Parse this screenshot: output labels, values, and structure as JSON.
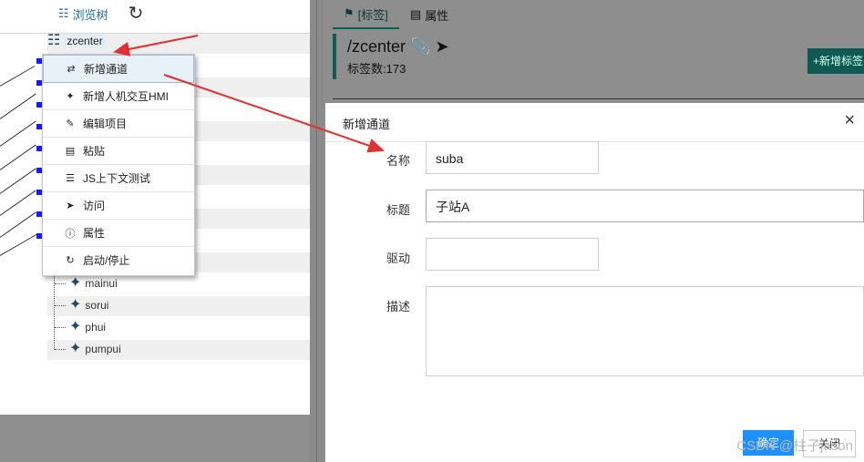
{
  "tree": {
    "header_label": "浏览树",
    "root": "zcenter",
    "children": [
      "mainui",
      "sorui",
      "phui",
      "pumpui"
    ]
  },
  "context_menu": {
    "items": [
      {
        "icon": "shuffle-icon",
        "label": "新增通道"
      },
      {
        "icon": "puzzle-icon",
        "label": "新增人机交互HMI"
      },
      {
        "icon": "pencil-icon",
        "label": "编辑项目"
      },
      {
        "icon": "clipboard-icon",
        "label": "粘贴"
      },
      {
        "icon": "list-icon",
        "label": "JS上下文测试"
      },
      {
        "icon": "send-icon",
        "label": "访问"
      },
      {
        "icon": "info-icon",
        "label": "属性"
      },
      {
        "icon": "refresh-icon",
        "label": "启动/停止"
      }
    ]
  },
  "right": {
    "tabs": [
      {
        "label": "[标签]"
      },
      {
        "label": "属性"
      }
    ],
    "title": "/zcenter",
    "tag_count": "标签数:173",
    "new_tag_button": "+新增标签"
  },
  "modal": {
    "title": "新增通道",
    "close_symbol": "×",
    "fields": [
      {
        "label": "名称",
        "value": "suba"
      },
      {
        "label": "标题",
        "value": "子站A"
      },
      {
        "label": "驱动",
        "value": ""
      },
      {
        "label": "描述",
        "value": ""
      }
    ],
    "ok_label": "确定",
    "cancel_label": "关闭"
  },
  "watermark": "CSDN @柱子jason",
  "colors": {
    "accent": "#0e5c54",
    "primary_button": "#1e90ff",
    "arrow": "#e03030",
    "tree_node": "#1a1aff"
  }
}
